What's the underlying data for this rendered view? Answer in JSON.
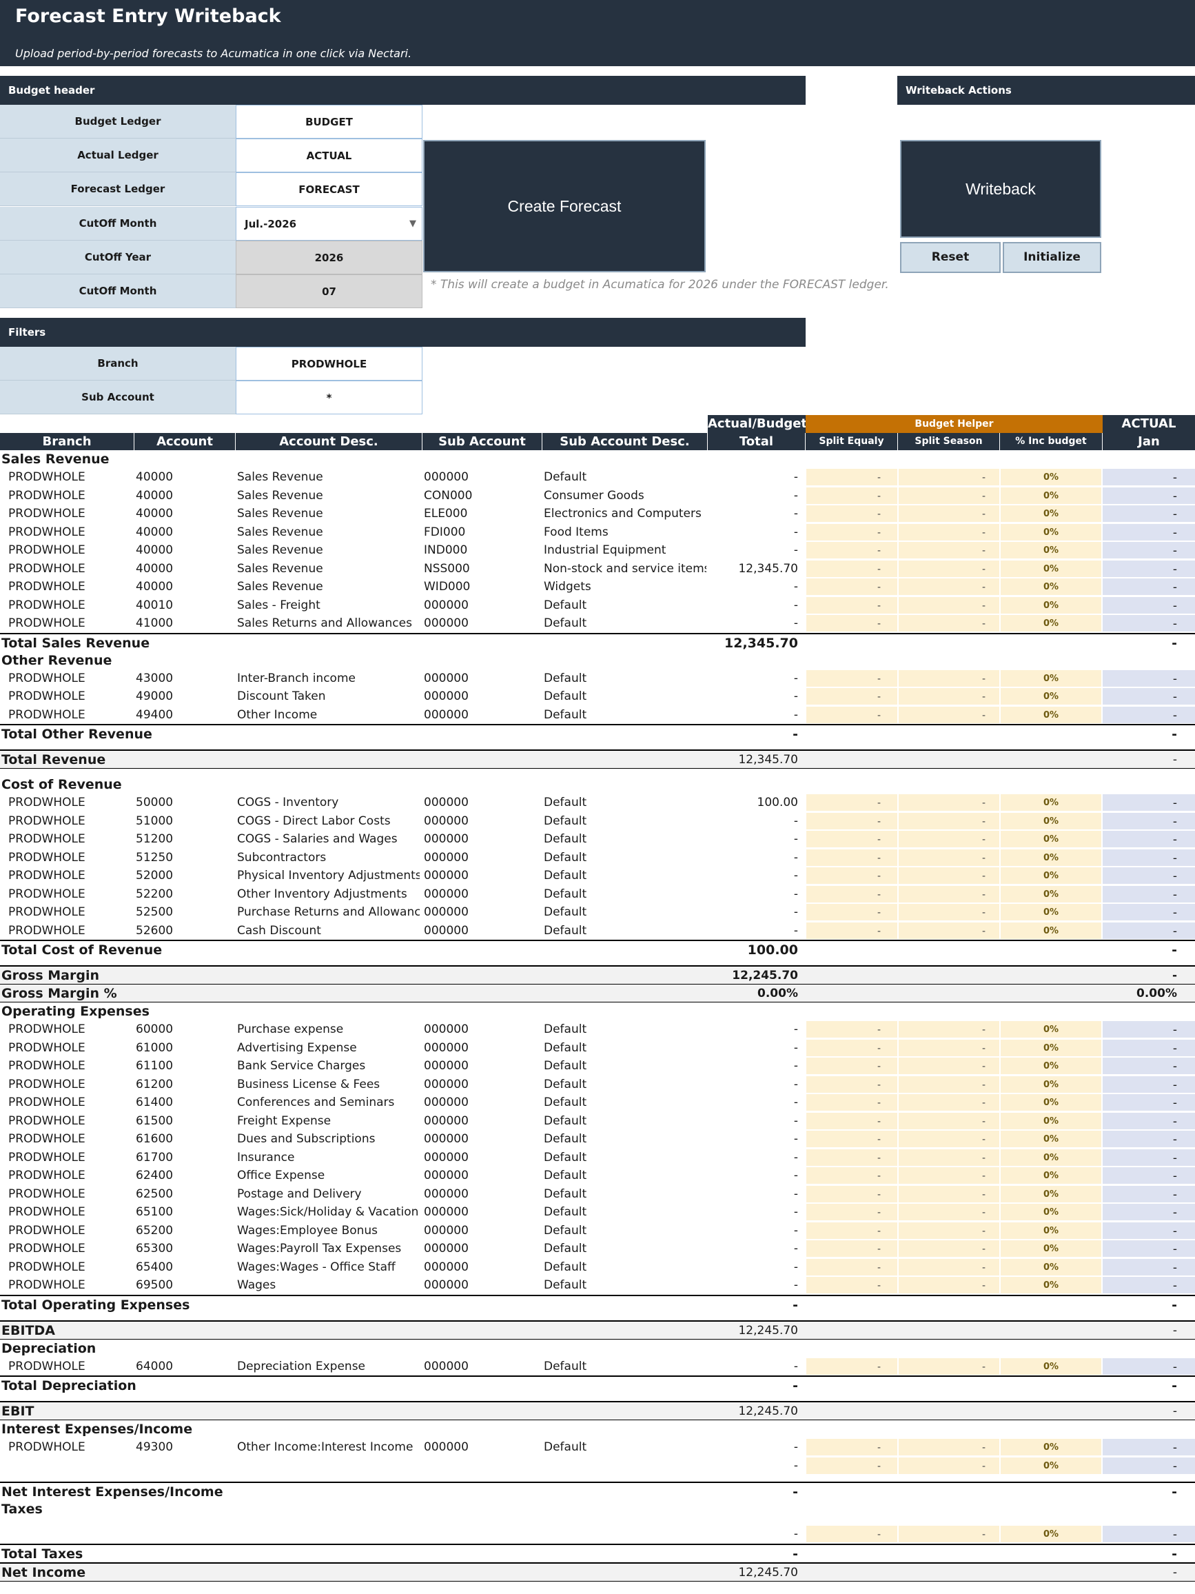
{
  "header": {
    "title": "Forecast Entry Writeback",
    "subtitle": "Upload period-by-period forecasts to Acumatica in one click via Nectari."
  },
  "budget_header": {
    "title": "Budget header",
    "fields": [
      {
        "label": "Budget Ledger",
        "value": "BUDGET"
      },
      {
        "label": "Actual Ledger",
        "value": "ACTUAL"
      },
      {
        "label": "Forecast Ledger",
        "value": "FORECAST"
      },
      {
        "label": "CutOff Month",
        "value": "Jul.-2026"
      },
      {
        "label": "CutOff Year",
        "value": "2026"
      },
      {
        "label": "CutOff Month",
        "value": "07"
      }
    ]
  },
  "actions": {
    "create_forecast": "Create Forecast",
    "note": "* This will create a budget in Acumatica for 2026 under the FORECAST ledger.",
    "section_title": "Writeback Actions",
    "writeback": "Writeback",
    "reset": "Reset",
    "initialize": "Initialize"
  },
  "filters": {
    "title": "Filters",
    "fields": [
      {
        "label": "Branch",
        "value": "PRODWHOLE"
      },
      {
        "label": "Sub Account",
        "value": "*"
      }
    ]
  },
  "table_headers": {
    "group_actual_budget": "Actual/Budget",
    "group_budget_helper": "Budget Helper",
    "group_actual": "ACTUAL",
    "branch": "Branch",
    "account": "Account",
    "account_desc": "Account Desc.",
    "sub_account": "Sub Account",
    "sub_account_desc": "Sub Account Desc.",
    "total": "Total",
    "split_equaly": "Split Equaly",
    "split_season": "Split Season",
    "pct_inc_budget": "% Inc budget",
    "jan": "Jan"
  },
  "rows": [
    {
      "type": "section",
      "label": "Sales Revenue"
    },
    {
      "type": "data",
      "branch": "PRODWHOLE",
      "account": "40000",
      "desc": "Sales Revenue",
      "sub": "000000",
      "subdesc": "Default",
      "total": "-",
      "split_eq": "-",
      "split_season": "-",
      "pct": "0%",
      "jan": "-"
    },
    {
      "type": "data",
      "branch": "PRODWHOLE",
      "account": "40000",
      "desc": "Sales Revenue",
      "sub": "CON000",
      "subdesc": "Consumer Goods",
      "total": "-",
      "split_eq": "-",
      "split_season": "-",
      "pct": "0%",
      "jan": "-"
    },
    {
      "type": "data",
      "branch": "PRODWHOLE",
      "account": "40000",
      "desc": "Sales Revenue",
      "sub": "ELE000",
      "subdesc": "Electronics and Computers",
      "total": "-",
      "split_eq": "-",
      "split_season": "-",
      "pct": "0%",
      "jan": "-"
    },
    {
      "type": "data",
      "branch": "PRODWHOLE",
      "account": "40000",
      "desc": "Sales Revenue",
      "sub": "FDI000",
      "subdesc": "Food Items",
      "total": "-",
      "split_eq": "-",
      "split_season": "-",
      "pct": "0%",
      "jan": "-"
    },
    {
      "type": "data",
      "branch": "PRODWHOLE",
      "account": "40000",
      "desc": "Sales Revenue",
      "sub": "IND000",
      "subdesc": "Industrial Equipment",
      "total": "-",
      "split_eq": "-",
      "split_season": "-",
      "pct": "0%",
      "jan": "-"
    },
    {
      "type": "data",
      "branch": "PRODWHOLE",
      "account": "40000",
      "desc": "Sales Revenue",
      "sub": "NSS000",
      "subdesc": "Non-stock and service items",
      "total": "12,345.70",
      "split_eq": "-",
      "split_season": "-",
      "pct": "0%",
      "jan": "-"
    },
    {
      "type": "data",
      "branch": "PRODWHOLE",
      "account": "40000",
      "desc": "Sales Revenue",
      "sub": "WID000",
      "subdesc": "Widgets",
      "total": "-",
      "split_eq": "-",
      "split_season": "-",
      "pct": "0%",
      "jan": "-"
    },
    {
      "type": "data",
      "branch": "PRODWHOLE",
      "account": "40010",
      "desc": "Sales - Freight",
      "sub": "000000",
      "subdesc": "Default",
      "total": "-",
      "split_eq": "-",
      "split_season": "-",
      "pct": "0%",
      "jan": "-"
    },
    {
      "type": "data",
      "branch": "PRODWHOLE",
      "account": "41000",
      "desc": "Sales Returns and Allowances",
      "sub": "000000",
      "subdesc": "Default",
      "total": "-",
      "split_eq": "-",
      "split_season": "-",
      "pct": "0%",
      "jan": "-"
    },
    {
      "type": "total",
      "label": "Total Sales Revenue",
      "total": "12,345.70",
      "jan": "-"
    },
    {
      "type": "section",
      "label": "Other Revenue"
    },
    {
      "type": "data",
      "branch": "PRODWHOLE",
      "account": "43000",
      "desc": "Inter-Branch income",
      "sub": "000000",
      "subdesc": "Default",
      "total": "-",
      "split_eq": "-",
      "split_season": "-",
      "pct": "0%",
      "jan": "-"
    },
    {
      "type": "data",
      "branch": "PRODWHOLE",
      "account": "49000",
      "desc": "Discount Taken",
      "sub": "000000",
      "subdesc": "Default",
      "total": "-",
      "split_eq": "-",
      "split_season": "-",
      "pct": "0%",
      "jan": "-"
    },
    {
      "type": "data",
      "branch": "PRODWHOLE",
      "account": "49400",
      "desc": "Other Income",
      "sub": "000000",
      "subdesc": "Default",
      "total": "-",
      "split_eq": "-",
      "split_season": "-",
      "pct": "0%",
      "jan": "-"
    },
    {
      "type": "total",
      "label": "Total Other Revenue",
      "total": "-",
      "jan": "-"
    },
    {
      "type": "spacer"
    },
    {
      "type": "band",
      "label": "Total Revenue",
      "total": "12,345.70",
      "jan": "-"
    },
    {
      "type": "spacer"
    },
    {
      "type": "section",
      "label": "Cost of Revenue"
    },
    {
      "type": "data",
      "branch": "PRODWHOLE",
      "account": "50000",
      "desc": "COGS - Inventory",
      "sub": "000000",
      "subdesc": "Default",
      "total": "100.00",
      "split_eq": "-",
      "split_season": "-",
      "pct": "0%",
      "jan": "-"
    },
    {
      "type": "data",
      "branch": "PRODWHOLE",
      "account": "51000",
      "desc": "COGS - Direct Labor Costs",
      "sub": "000000",
      "subdesc": "Default",
      "total": "-",
      "split_eq": "-",
      "split_season": "-",
      "pct": "0%",
      "jan": "-"
    },
    {
      "type": "data",
      "branch": "PRODWHOLE",
      "account": "51200",
      "desc": "COGS - Salaries and Wages",
      "sub": "000000",
      "subdesc": "Default",
      "total": "-",
      "split_eq": "-",
      "split_season": "-",
      "pct": "0%",
      "jan": "-"
    },
    {
      "type": "data",
      "branch": "PRODWHOLE",
      "account": "51250",
      "desc": "Subcontractors",
      "sub": "000000",
      "subdesc": "Default",
      "total": "-",
      "split_eq": "-",
      "split_season": "-",
      "pct": "0%",
      "jan": "-"
    },
    {
      "type": "data",
      "branch": "PRODWHOLE",
      "account": "52000",
      "desc": "Physical Inventory Adjustments",
      "sub": "000000",
      "subdesc": "Default",
      "total": "-",
      "split_eq": "-",
      "split_season": "-",
      "pct": "0%",
      "jan": "-"
    },
    {
      "type": "data",
      "branch": "PRODWHOLE",
      "account": "52200",
      "desc": "Other Inventory Adjustments",
      "sub": "000000",
      "subdesc": "Default",
      "total": "-",
      "split_eq": "-",
      "split_season": "-",
      "pct": "0%",
      "jan": "-"
    },
    {
      "type": "data",
      "branch": "PRODWHOLE",
      "account": "52500",
      "desc": "Purchase Returns and Allowances",
      "sub": "000000",
      "subdesc": "Default",
      "total": "-",
      "split_eq": "-",
      "split_season": "-",
      "pct": "0%",
      "jan": "-"
    },
    {
      "type": "data",
      "branch": "PRODWHOLE",
      "account": "52600",
      "desc": "Cash Discount",
      "sub": "000000",
      "subdesc": "Default",
      "total": "-",
      "split_eq": "-",
      "split_season": "-",
      "pct": "0%",
      "jan": "-"
    },
    {
      "type": "total",
      "label": "Total Cost of Revenue",
      "total": "100.00",
      "jan": "-"
    },
    {
      "type": "spacer"
    },
    {
      "type": "band",
      "label": "Gross Margin",
      "total": "12,245.70",
      "jan": "-",
      "bold": true
    },
    {
      "type": "band2",
      "label": "Gross Margin %",
      "total": "0.00%",
      "jan": "0.00%",
      "bold": true
    },
    {
      "type": "section",
      "label": "Operating Expenses"
    },
    {
      "type": "data",
      "branch": "PRODWHOLE",
      "account": "60000",
      "desc": "Purchase expense",
      "sub": "000000",
      "subdesc": "Default",
      "total": "-",
      "split_eq": "-",
      "split_season": "-",
      "pct": "0%",
      "jan": "-"
    },
    {
      "type": "data",
      "branch": "PRODWHOLE",
      "account": "61000",
      "desc": "Advertising Expense",
      "sub": "000000",
      "subdesc": "Default",
      "total": "-",
      "split_eq": "-",
      "split_season": "-",
      "pct": "0%",
      "jan": "-"
    },
    {
      "type": "data",
      "branch": "PRODWHOLE",
      "account": "61100",
      "desc": "Bank Service Charges",
      "sub": "000000",
      "subdesc": "Default",
      "total": "-",
      "split_eq": "-",
      "split_season": "-",
      "pct": "0%",
      "jan": "-"
    },
    {
      "type": "data",
      "branch": "PRODWHOLE",
      "account": "61200",
      "desc": "Business License & Fees",
      "sub": "000000",
      "subdesc": "Default",
      "total": "-",
      "split_eq": "-",
      "split_season": "-",
      "pct": "0%",
      "jan": "-"
    },
    {
      "type": "data",
      "branch": "PRODWHOLE",
      "account": "61400",
      "desc": "Conferences and Seminars",
      "sub": "000000",
      "subdesc": "Default",
      "total": "-",
      "split_eq": "-",
      "split_season": "-",
      "pct": "0%",
      "jan": "-"
    },
    {
      "type": "data",
      "branch": "PRODWHOLE",
      "account": "61500",
      "desc": "Freight Expense",
      "sub": "000000",
      "subdesc": "Default",
      "total": "-",
      "split_eq": "-",
      "split_season": "-",
      "pct": "0%",
      "jan": "-"
    },
    {
      "type": "data",
      "branch": "PRODWHOLE",
      "account": "61600",
      "desc": "Dues and Subscriptions",
      "sub": "000000",
      "subdesc": "Default",
      "total": "-",
      "split_eq": "-",
      "split_season": "-",
      "pct": "0%",
      "jan": "-"
    },
    {
      "type": "data",
      "branch": "PRODWHOLE",
      "account": "61700",
      "desc": "Insurance",
      "sub": "000000",
      "subdesc": "Default",
      "total": "-",
      "split_eq": "-",
      "split_season": "-",
      "pct": "0%",
      "jan": "-"
    },
    {
      "type": "data",
      "branch": "PRODWHOLE",
      "account": "62400",
      "desc": "Office Expense",
      "sub": "000000",
      "subdesc": "Default",
      "total": "-",
      "split_eq": "-",
      "split_season": "-",
      "pct": "0%",
      "jan": "-"
    },
    {
      "type": "data",
      "branch": "PRODWHOLE",
      "account": "62500",
      "desc": "Postage and Delivery",
      "sub": "000000",
      "subdesc": "Default",
      "total": "-",
      "split_eq": "-",
      "split_season": "-",
      "pct": "0%",
      "jan": "-"
    },
    {
      "type": "data",
      "branch": "PRODWHOLE",
      "account": "65100",
      "desc": "Wages:Sick/Holiday & Vacation Pa",
      "sub": "000000",
      "subdesc": "Default",
      "total": "-",
      "split_eq": "-",
      "split_season": "-",
      "pct": "0%",
      "jan": "-"
    },
    {
      "type": "data",
      "branch": "PRODWHOLE",
      "account": "65200",
      "desc": "Wages:Employee Bonus",
      "sub": "000000",
      "subdesc": "Default",
      "total": "-",
      "split_eq": "-",
      "split_season": "-",
      "pct": "0%",
      "jan": "-"
    },
    {
      "type": "data",
      "branch": "PRODWHOLE",
      "account": "65300",
      "desc": "Wages:Payroll Tax Expenses",
      "sub": "000000",
      "subdesc": "Default",
      "total": "-",
      "split_eq": "-",
      "split_season": "-",
      "pct": "0%",
      "jan": "-"
    },
    {
      "type": "data",
      "branch": "PRODWHOLE",
      "account": "65400",
      "desc": "Wages:Wages - Office Staff",
      "sub": "000000",
      "subdesc": "Default",
      "total": "-",
      "split_eq": "-",
      "split_season": "-",
      "pct": "0%",
      "jan": "-"
    },
    {
      "type": "data",
      "branch": "PRODWHOLE",
      "account": "69500",
      "desc": "Wages",
      "sub": "000000",
      "subdesc": "Default",
      "total": "-",
      "split_eq": "-",
      "split_season": "-",
      "pct": "0%",
      "jan": "-"
    },
    {
      "type": "total",
      "label": "Total Operating Expenses",
      "total": "-",
      "jan": "-"
    },
    {
      "type": "spacer"
    },
    {
      "type": "band",
      "label": "EBITDA",
      "total": "12,245.70",
      "jan": "-"
    },
    {
      "type": "section",
      "label": "Depreciation"
    },
    {
      "type": "data",
      "branch": "PRODWHOLE",
      "account": "64000",
      "desc": "Depreciation Expense",
      "sub": "000000",
      "subdesc": "Default",
      "total": "-",
      "split_eq": "-",
      "split_season": "-",
      "pct": "0%",
      "jan": "-"
    },
    {
      "type": "total",
      "label": "Total Depreciation",
      "total": "-",
      "jan": "-"
    },
    {
      "type": "spacer"
    },
    {
      "type": "band",
      "label": "EBIT",
      "total": "12,245.70",
      "jan": "-"
    },
    {
      "type": "section",
      "label": "Interest Expenses/Income"
    },
    {
      "type": "data",
      "branch": "PRODWHOLE",
      "account": "49300",
      "desc": "Other Income:Interest Income",
      "sub": "000000",
      "subdesc": "Default",
      "total": "-",
      "split_eq": "-",
      "split_season": "-",
      "pct": "0%",
      "jan": "-"
    },
    {
      "type": "data",
      "branch": "",
      "account": "",
      "desc": "",
      "sub": "",
      "subdesc": "",
      "total": "-",
      "split_eq": "-",
      "split_season": "-",
      "pct": "0%",
      "jan": "-"
    },
    {
      "type": "spacer"
    },
    {
      "type": "total",
      "label": "Net Interest Expenses/Income",
      "total": "-",
      "jan": "-"
    },
    {
      "type": "section",
      "label": "Taxes"
    },
    {
      "type": "spacer"
    },
    {
      "type": "data",
      "branch": "",
      "account": "",
      "desc": "",
      "sub": "",
      "subdesc": "",
      "total": "-",
      "split_eq": "-",
      "split_season": "-",
      "pct": "0%",
      "jan": "-"
    },
    {
      "type": "total",
      "label": "Total Taxes",
      "total": "-",
      "jan": "-"
    },
    {
      "type": "band",
      "label": "Net Income",
      "total": "12,245.70",
      "jan": "-"
    }
  ]
}
